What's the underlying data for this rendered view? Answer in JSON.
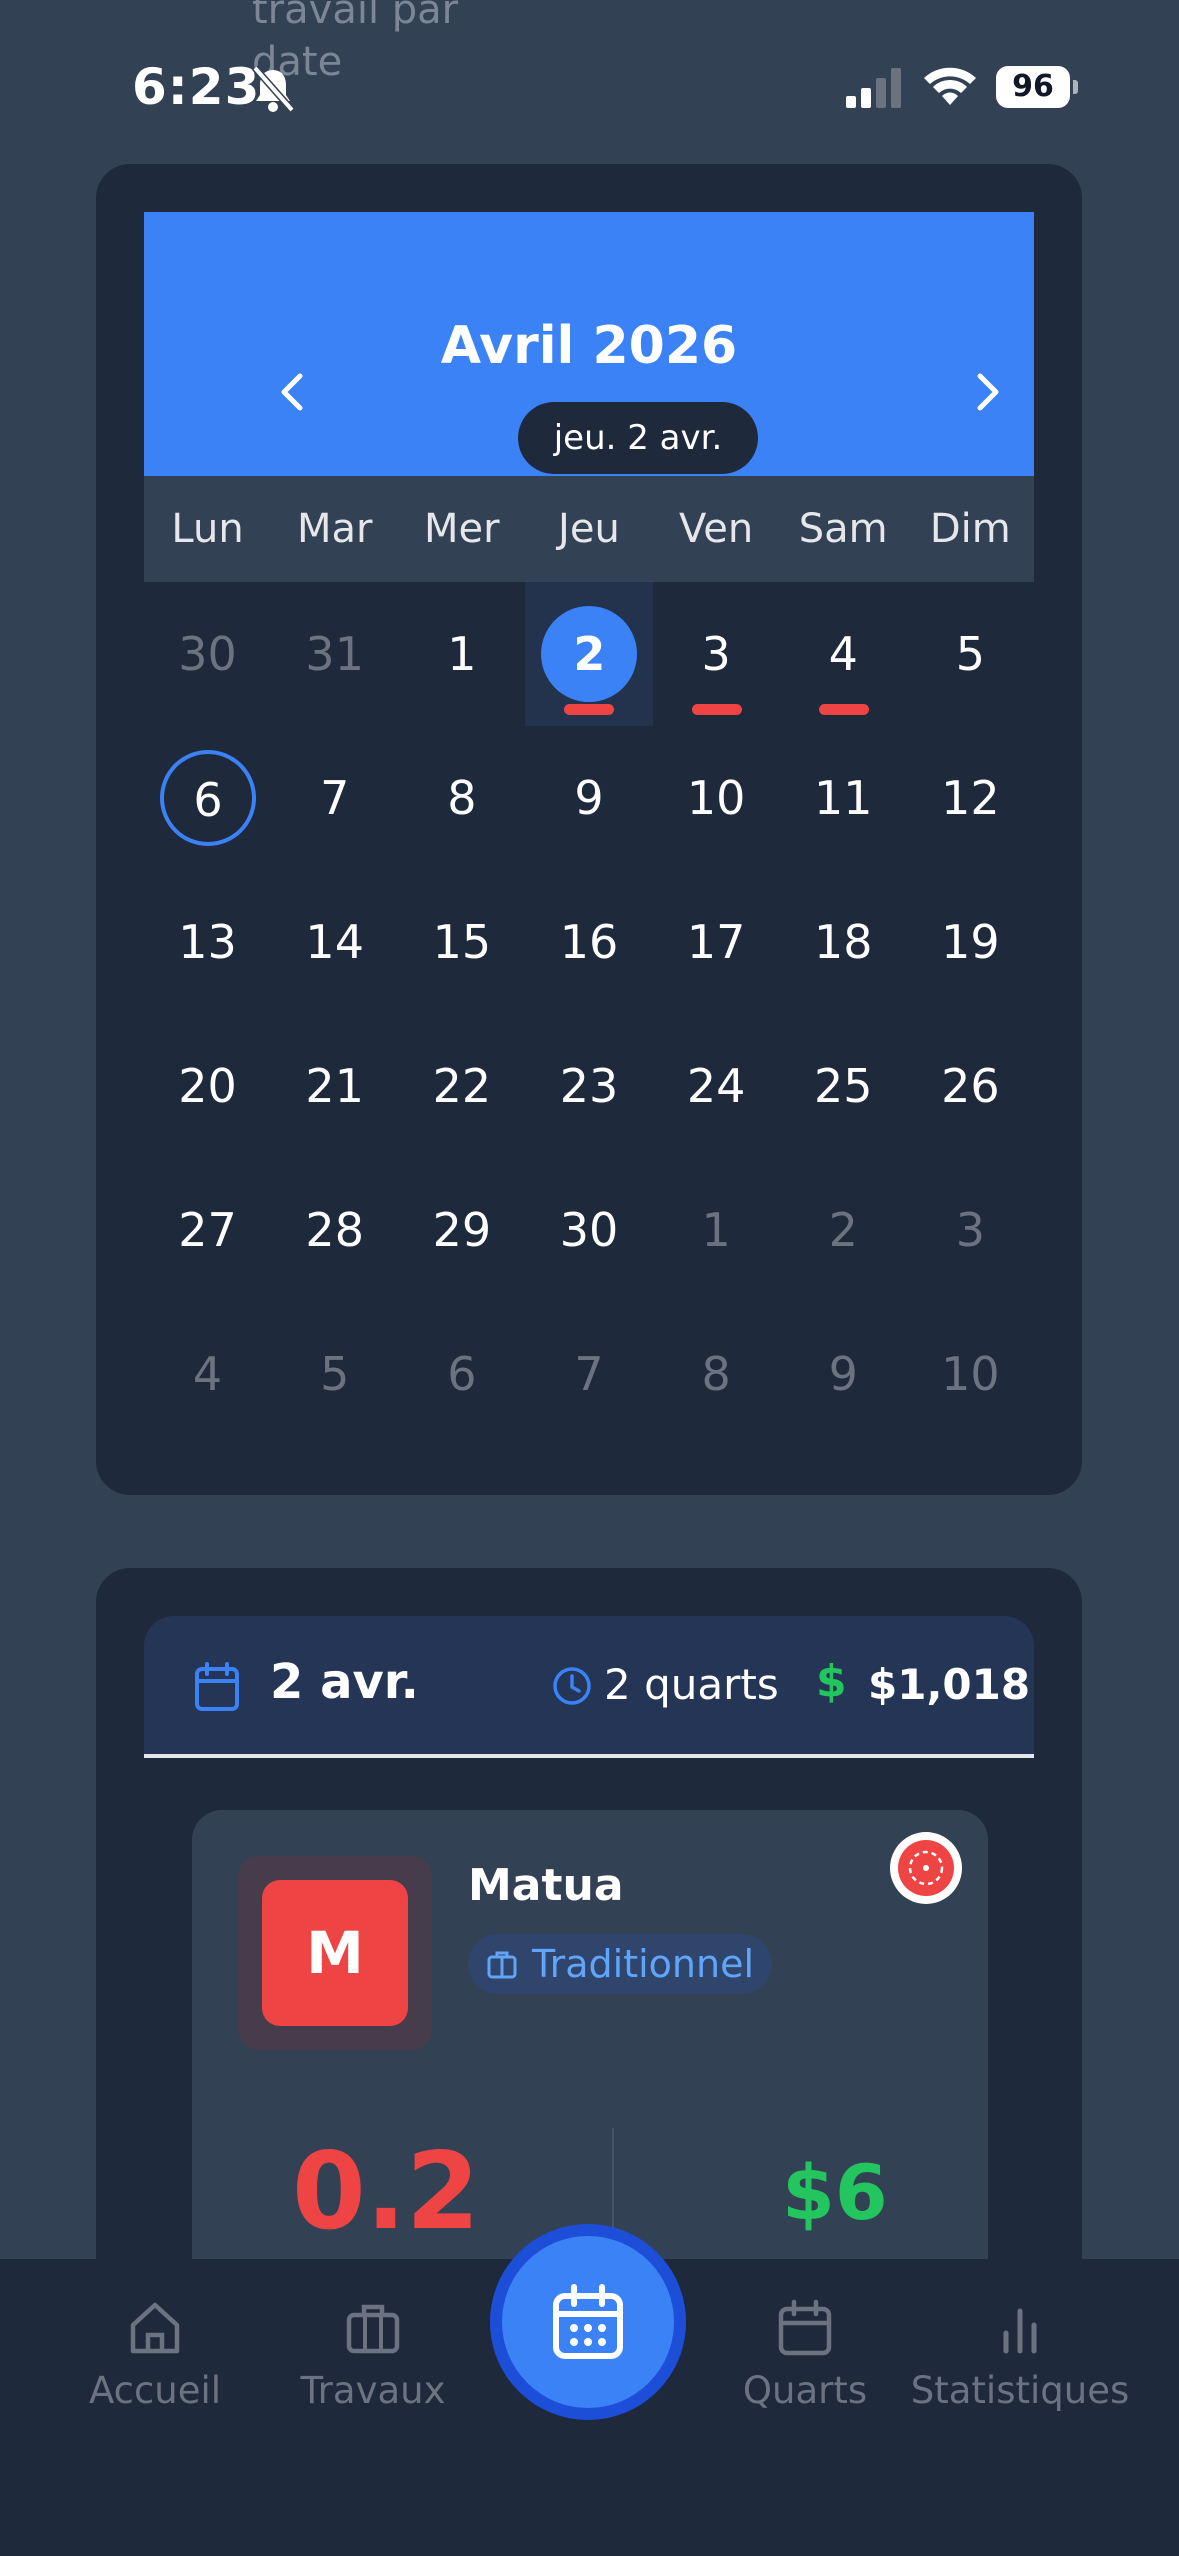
{
  "status_bar": {
    "time": "6:23",
    "battery": "96",
    "ghost_title": "travail par date",
    "icons": [
      "bell-slash-icon",
      "signal-icon",
      "wifi-icon",
      "battery-icon"
    ]
  },
  "calendar": {
    "month_title": "Avril 2026",
    "selected_pill": "jeu. 2 avr.",
    "weekdays": [
      "Lun",
      "Mar",
      "Mer",
      "Jeu",
      "Ven",
      "Sam",
      "Dim"
    ],
    "accent": "#3b82f6",
    "marker_color": "#ef4444",
    "weeks": [
      [
        "30",
        "31",
        "1",
        "2",
        "3",
        "4",
        "5"
      ],
      [
        "6",
        "7",
        "8",
        "9",
        "10",
        "11",
        "12"
      ],
      [
        "13",
        "14",
        "15",
        "16",
        "17",
        "18",
        "19"
      ],
      [
        "20",
        "21",
        "22",
        "23",
        "24",
        "25",
        "26"
      ],
      [
        "27",
        "28",
        "29",
        "30",
        "1",
        "2",
        "3"
      ],
      [
        "4",
        "5",
        "6",
        "7",
        "8",
        "9",
        "10"
      ]
    ]
  },
  "day_summary": {
    "date": "2 avr.",
    "shifts": "2 quarts",
    "currency": "$",
    "amount": "$1,018"
  },
  "job": {
    "avatar_letter": "M",
    "name": "Matua",
    "tag": "Traditionnel",
    "stat_left": "0.2",
    "stat_right": "$6"
  },
  "tabs": [
    {
      "label": "Accueil",
      "icon": "home-icon"
    },
    {
      "label": "Travaux",
      "icon": "briefcase-icon"
    },
    {
      "label": "",
      "icon": "calendar-icon"
    },
    {
      "label": "Quarts",
      "icon": "calendar-icon"
    },
    {
      "label": "Statistiques",
      "icon": "bar-chart-icon"
    }
  ]
}
